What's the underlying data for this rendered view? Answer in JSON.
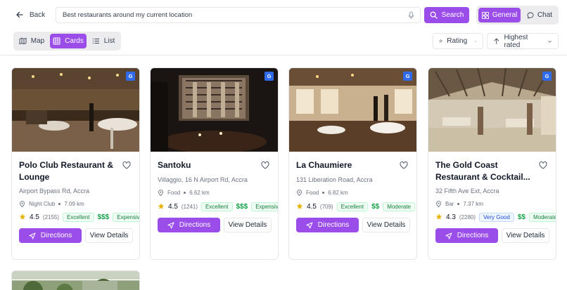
{
  "header": {
    "back_label": "Back",
    "search_value": "Best restaurants around my current location",
    "search_button": "Search",
    "modes": {
      "general": "General",
      "chat": "Chat"
    }
  },
  "toolbar": {
    "views": {
      "map": "Map",
      "cards": "Cards",
      "list": "List"
    },
    "sort_rating": "Rating",
    "sort_order": "Highest rated"
  },
  "colors": {
    "accent": "#9b4dea",
    "google_badge": "#2f6bea",
    "price": "#16a34a"
  },
  "cards": [
    {
      "badge": "G",
      "name": "Polo Club Restaurant & Lounge",
      "address": "Airport Bypass Rd, Accra",
      "category": "Night Club",
      "distance": "7.09 km",
      "rating": "4.5",
      "reviews": "(2155)",
      "quality": "Excellent",
      "price": "$$$",
      "price_label": "Expensive",
      "directions": "Directions",
      "details": "View Details"
    },
    {
      "badge": "G",
      "name": "Santoku",
      "address": "Villaggio, 16 N Airport Rd, Accra",
      "category": "Food",
      "distance": "6.62 km",
      "rating": "4.5",
      "reviews": "(1241)",
      "quality": "Excellent",
      "price": "$$$",
      "price_label": "Expensive",
      "directions": "Directions",
      "details": "View Details"
    },
    {
      "badge": "G",
      "name": "La Chaumiere",
      "address": "131 Liberation Road, Accra",
      "category": "Food",
      "distance": "6.82 km",
      "rating": "4.5",
      "reviews": "(709)",
      "quality": "Excellent",
      "price": "$$",
      "price_label": "Moderate",
      "directions": "Directions",
      "details": "View Details"
    },
    {
      "badge": "G",
      "name": "The Gold Coast Restaurant & Cocktail...",
      "address": "32 Fifth Ave Ext, Accra",
      "category": "Bar",
      "distance": "7.37 km",
      "rating": "4.3",
      "reviews": "(2280)",
      "quality": "Very Good",
      "price": "$$",
      "price_label": "Moderate",
      "directions": "Directions",
      "details": "View Details"
    }
  ]
}
